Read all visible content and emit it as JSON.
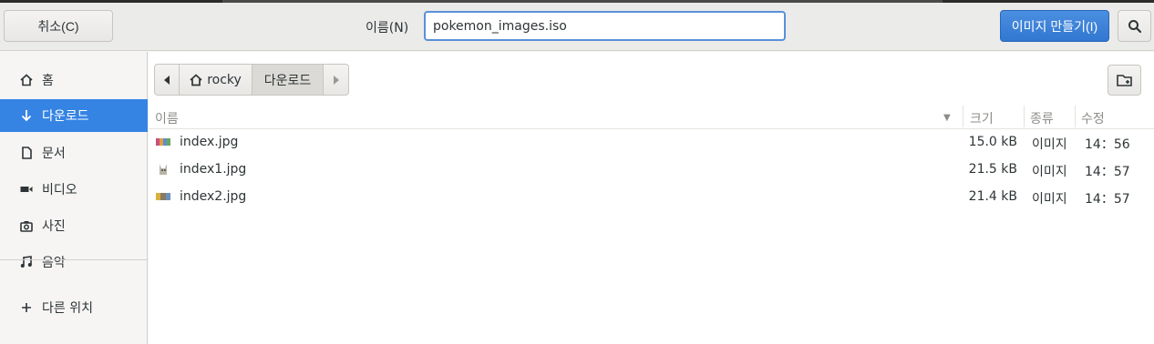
{
  "header": {
    "cancel_label": "취소(C)",
    "name_label": "이름(N)",
    "filename_value": "pokemon_images.iso",
    "create_label": "이미지 만들기(I)",
    "search_icon": "search-icon"
  },
  "sidebar": {
    "items": [
      {
        "label": "홈",
        "icon": "home-icon"
      },
      {
        "label": "다운로드",
        "icon": "download-arrow-icon"
      },
      {
        "label": "문서",
        "icon": "document-icon"
      },
      {
        "label": "비디오",
        "icon": "video-icon"
      },
      {
        "label": "사진",
        "icon": "camera-icon"
      },
      {
        "label": "음악",
        "icon": "music-icon"
      },
      {
        "label": "다른 위치",
        "icon": "plus-icon"
      }
    ]
  },
  "pathbar": {
    "home": "rocky",
    "current": "다운로드"
  },
  "columns": {
    "name": "이름",
    "size": "크기",
    "type": "종류",
    "modified": "수정"
  },
  "files": [
    {
      "name": "index.jpg",
      "size": "15.0 kB",
      "type": "이미지",
      "modified": "14：56"
    },
    {
      "name": "index1.jpg",
      "size": "21.5 kB",
      "type": "이미지",
      "modified": "14：57"
    },
    {
      "name": "index2.jpg",
      "size": "21.4 kB",
      "type": "이미지",
      "modified": "14：57"
    }
  ],
  "colors": {
    "accent": "#3584e4",
    "input_border": "#5a90d9"
  }
}
